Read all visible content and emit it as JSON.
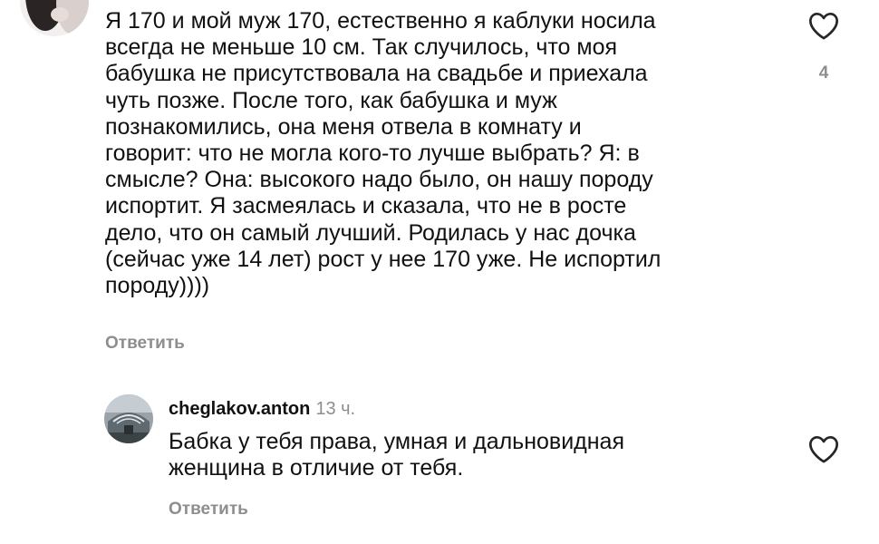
{
  "comments": [
    {
      "text": "Я 170 и мой муж 170, естественно я каблуки носила\nвсегда не меньше 10 см. Так случилось, что моя\nбабушка не присутствовала на свадьбе и приехала\nчуть позже. После того, как бабушка и муж\nпознакомились, она меня отвела в комнату и\nговорит: что не могла кого-то лучше выбрать? Я: в\nсмысле? Она: высокого надо было, он нашу породу\nиспортит. Я засмеялась и сказала, что не в росте\nдело, что он самый лучший. Родилась у нас дочка\n(сейчас уже 14 лет) рост у нее 170 уже. Не испортил\nпороду))))",
      "reply_label": "Ответить",
      "like_count": "4",
      "like_icon": "heart-outline-icon"
    },
    {
      "username": "cheglakov.anton",
      "timestamp": "13 ч.",
      "text": "Бабка у тебя права, умная и дальновидная\nженщина в отличие от тебя.",
      "reply_label": "Ответить",
      "like_icon": "heart-outline-icon"
    }
  ],
  "colors": {
    "text": "#111111",
    "muted": "#8e8e8e",
    "icon": "#262626"
  }
}
